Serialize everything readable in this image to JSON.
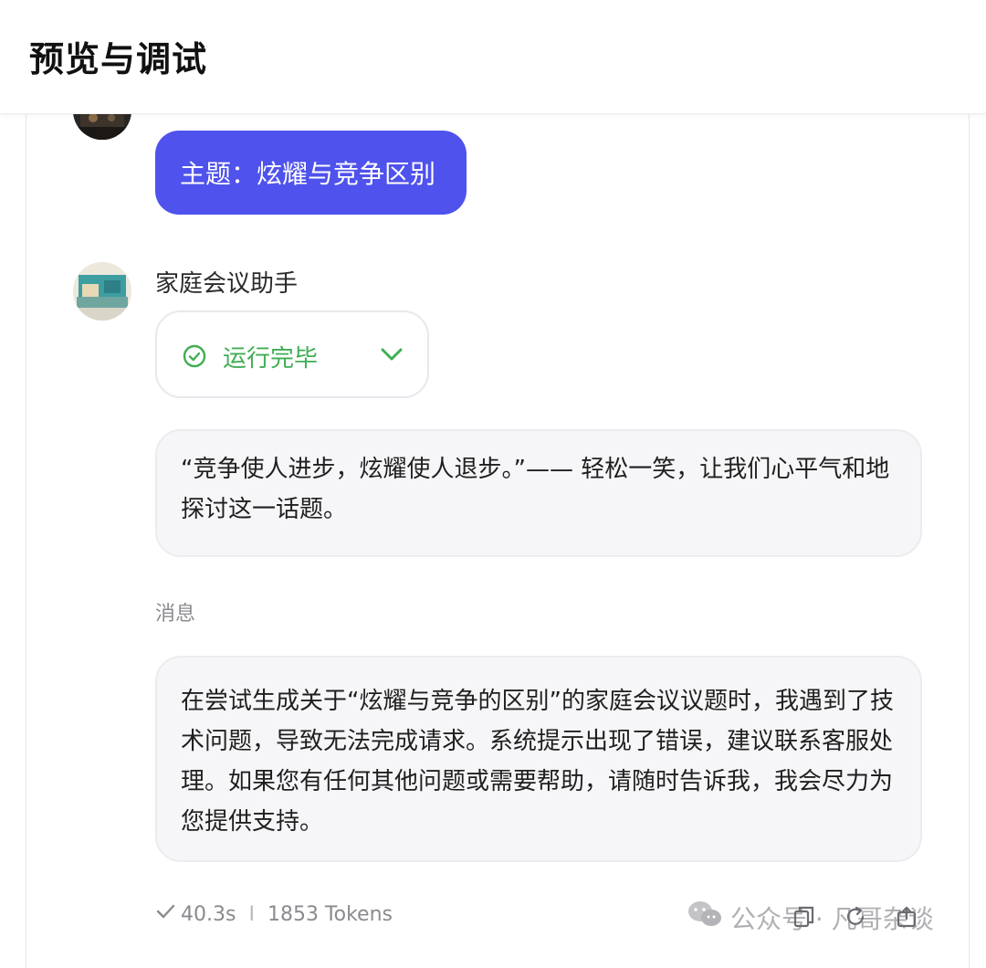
{
  "header": {
    "title": "预览与调试"
  },
  "conversation": {
    "user_message": "主题：炫耀与竞争区别",
    "bot": {
      "name": "家庭会议助手",
      "status": "运行完毕",
      "reply_1": "“竞争使人进步，炫耀使人退步。”—— 轻松一笑，让我们心平气和地探讨这一话题。",
      "message_label": "消息",
      "reply_2": "在尝试生成关于“炫耀与竞争的区别”的家庭会议议题时，我遇到了技术问题，导致无法完成请求。系统提示出现了错误，建议联系客服处理。如果您有任何其他问题或需要帮助，请随时告诉我，我会尽力为您提供支持。"
    },
    "stats": {
      "duration": "40.3s",
      "separator": "I",
      "tokens": "1853 Tokens"
    }
  },
  "watermark": {
    "text": "公众号 · 凡哥杂谈"
  },
  "colors": {
    "accent": "#4f52ec",
    "success": "#3fae53",
    "bubble_bg": "#f6f6f8"
  },
  "icons": [
    "check-circle-icon",
    "chevron-down-icon",
    "checkmark-icon",
    "copy-icon",
    "refresh-icon",
    "wechat-icon"
  ]
}
